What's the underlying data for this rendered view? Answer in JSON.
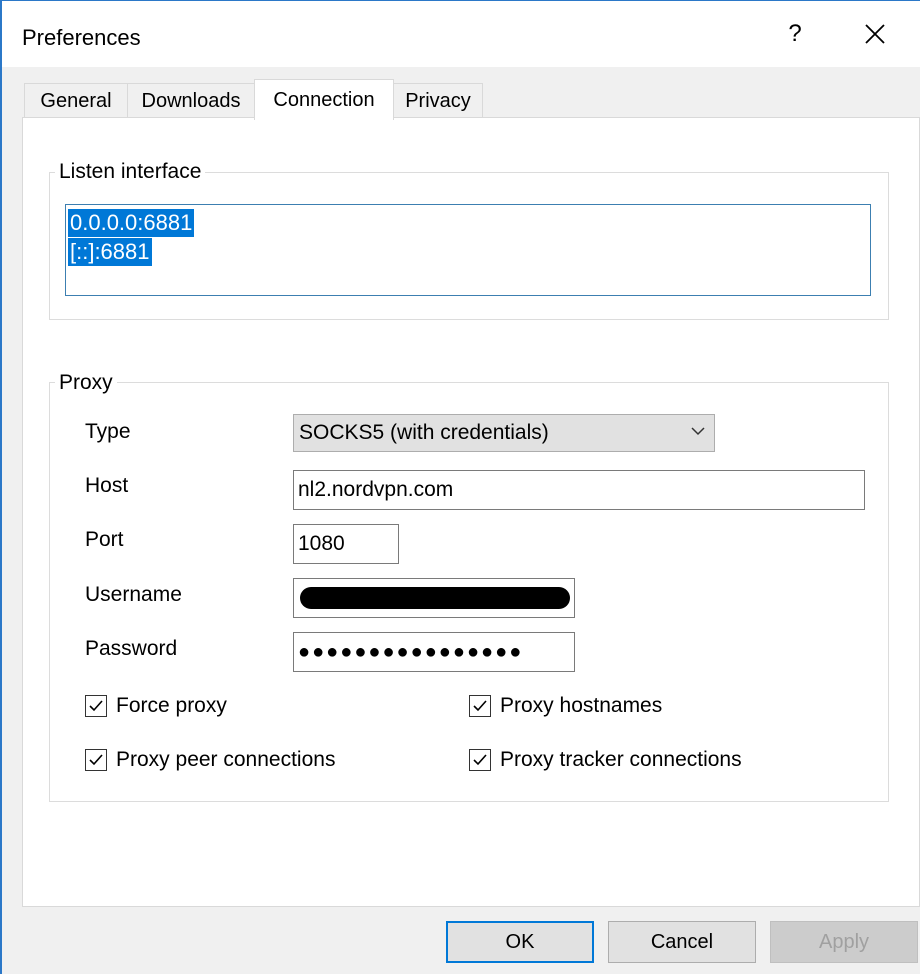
{
  "window": {
    "title": "Preferences",
    "help_label": "?",
    "close_icon": "close-icon"
  },
  "tabs": [
    {
      "label": "General",
      "active": false
    },
    {
      "label": "Downloads",
      "active": false
    },
    {
      "label": "Connection",
      "active": true
    },
    {
      "label": "Privacy",
      "active": false
    }
  ],
  "listen": {
    "title": "Listen interface",
    "items": [
      "0.0.0.0:6881",
      "[::]:6881"
    ]
  },
  "proxy": {
    "title": "Proxy",
    "type_label": "Type",
    "type_value": "SOCKS5 (with credentials)",
    "host_label": "Host",
    "host_value": "nl2.nordvpn.com",
    "port_label": "Port",
    "port_value": "1080",
    "username_label": "Username",
    "password_label": "Password",
    "password_mask": "●●●●●●●●●●●●●●●●",
    "checks": {
      "force_proxy": {
        "label": "Force proxy",
        "checked": true
      },
      "proxy_hostnames": {
        "label": "Proxy hostnames",
        "checked": true
      },
      "proxy_peer": {
        "label": "Proxy peer connections",
        "checked": true
      },
      "proxy_tracker": {
        "label": "Proxy tracker connections",
        "checked": true
      }
    }
  },
  "buttons": {
    "ok": "OK",
    "cancel": "Cancel",
    "apply": "Apply"
  },
  "colors": {
    "selection": "#0078d7",
    "window_border": "#2b78c8"
  }
}
